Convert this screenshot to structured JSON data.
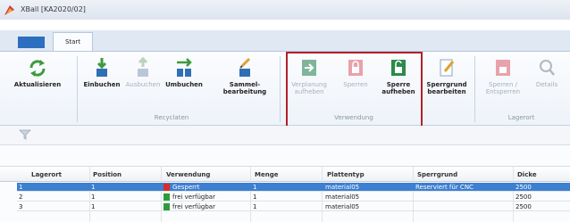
{
  "window": {
    "title": "XBall [KA2020/02]"
  },
  "ribbon": {
    "tabs": [
      {
        "label": ""
      },
      {
        "label": "Start"
      }
    ],
    "buttons": {
      "refresh": "Aktualisieren",
      "book_in": "Einbuchen",
      "book_out": "Ausbuchen",
      "rebook": "Umbuchen",
      "bulk_edit": "Sammel-\nbearbeitung",
      "undo_allocation": "Verplanung\naufheben",
      "lock": "Sperren",
      "unlock": "Sperre\naufheben",
      "lock_reason": "Sperrgrund\nbearbeiten",
      "lock_storage": "Sperren /\nEntsperren",
      "details": "Details"
    },
    "groups": {
      "recycling": "Recyclaten",
      "usage": "Verwendung",
      "storage": "Lagerort"
    }
  },
  "table": {
    "columns": [
      "Lagerort",
      "Position",
      "Verwendung",
      "Menge",
      "Plattentyp",
      "Sperrgrund",
      "Dicke"
    ],
    "rows": [
      {
        "lagerort": "1",
        "position": "1",
        "verwendung": "Gesperrt",
        "menge": "1",
        "plattentyp": "material05",
        "sperrgrund": "Reserviert für CNC",
        "dicke": "2500",
        "status_color": "#d92b2b",
        "selected": true
      },
      {
        "lagerort": "2",
        "position": "1",
        "verwendung": "frei verfügbar",
        "menge": "1",
        "plattentyp": "material05",
        "sperrgrund": "",
        "dicke": "2500",
        "status_color": "#2e9a3c",
        "selected": false
      },
      {
        "lagerort": "3",
        "position": "1",
        "verwendung": "frei verfügbar",
        "menge": "1",
        "plattentyp": "material05",
        "sperrgrund": "",
        "dicke": "2500",
        "status_color": "#2e9a3c",
        "selected": false
      }
    ]
  },
  "colors": {
    "accent": "#2b6fbe",
    "highlight": "#b3202a",
    "selection": "#3d7fd0"
  }
}
